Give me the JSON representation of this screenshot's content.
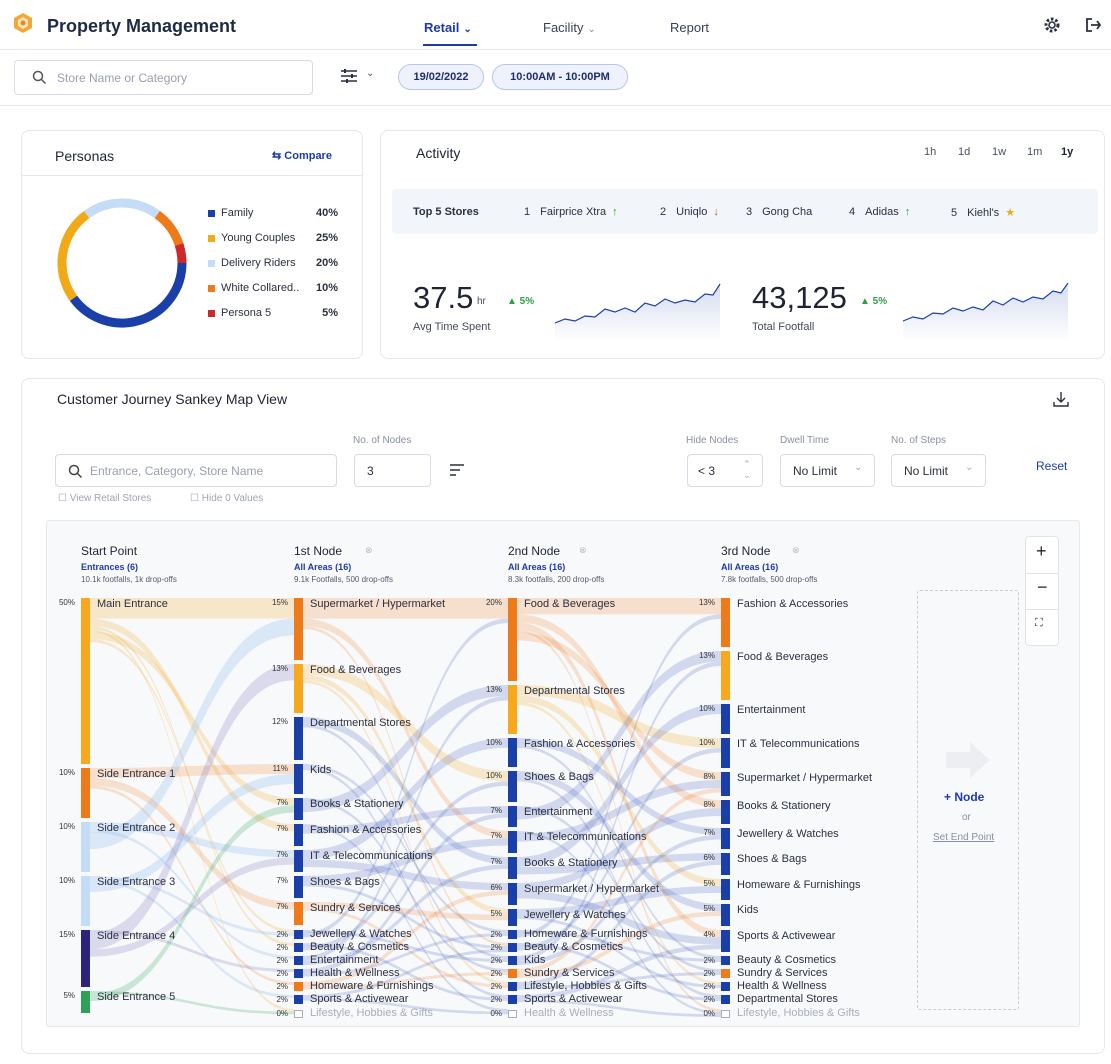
{
  "app": {
    "title": "Property Management"
  },
  "nav": {
    "retail": "Retail",
    "facility": "Facility",
    "report": "Report"
  },
  "filters": {
    "search_placeholder": "Store Name or Category",
    "date": "19/02/2022",
    "time": "10:00AM - 10:00PM"
  },
  "personas": {
    "title": "Personas",
    "compare": "Compare",
    "items": [
      {
        "label": "Family",
        "pct": "40%",
        "color": "#1a3fa8"
      },
      {
        "label": "Young Couples",
        "pct": "25%",
        "color": "#f2a918"
      },
      {
        "label": "Delivery Riders",
        "pct": "20%",
        "color": "#c4dcf5"
      },
      {
        "label": "White Collared..",
        "pct": "10%",
        "color": "#ef7a1a"
      },
      {
        "label": "Persona 5",
        "pct": "5%",
        "color": "#cc2a2a"
      }
    ]
  },
  "activity": {
    "title": "Activity",
    "ranges": [
      "1h",
      "1d",
      "1w",
      "1m",
      "1y"
    ],
    "top_label": "Top 5 Stores",
    "stores": [
      {
        "rank": "1",
        "name": "Fairprice Xtra",
        "trend": "↑"
      },
      {
        "rank": "2",
        "name": "Uniqlo",
        "trend": "↓"
      },
      {
        "rank": "3",
        "name": "Gong Cha",
        "trend": ""
      },
      {
        "rank": "4",
        "name": "Adidas",
        "trend": "↑"
      },
      {
        "rank": "5",
        "name": "Kiehl's",
        "trend": "★"
      }
    ],
    "metric1": {
      "value": "37.5",
      "unit": "hr",
      "change": "▲ 5%",
      "label": "Avg Time Spent"
    },
    "metric2": {
      "value": "43,125",
      "change": "▲ 5%",
      "label": "Total Footfall"
    }
  },
  "sankey": {
    "title": "Customer Journey Sankey Map View",
    "search_placeholder": "Entrance, Category, Store Name",
    "no_nodes_label": "No. of Nodes",
    "no_nodes_value": "3",
    "hide_nodes_label": "Hide Nodes",
    "hide_nodes_value": "< 3",
    "dwell_label": "Dwell Time",
    "dwell_value": "No Limit",
    "steps_label": "No. of Steps",
    "steps_value": "No Limit",
    "reset": "Reset",
    "view_retail": "View Retail Stores",
    "hide_zero": "Hide 0 Values",
    "add_node": "+ Node",
    "or": "or",
    "set_end": "Set End Point",
    "columns": [
      {
        "title": "Start Point",
        "sub": "Entrances (6)",
        "meta": "10.1k footfalls, 1k drop-offs",
        "nodes": [
          {
            "label": "Main Entrance",
            "pct": "50%",
            "color": "#f7a81c"
          },
          {
            "label": "Side Entrance 1",
            "pct": "10%",
            "color": "#ef7a1a"
          },
          {
            "label": "Side Entrance 2",
            "pct": "10%",
            "color": "#c4dcf5"
          },
          {
            "label": "Side Entrance 3",
            "pct": "10%",
            "color": "#c4dcf5"
          },
          {
            "label": "Side Entrance 4",
            "pct": "15%",
            "color": "#2e237a"
          },
          {
            "label": "Side Entrance 5",
            "pct": "5%",
            "color": "#2ea05a"
          }
        ]
      },
      {
        "title": "1st Node",
        "sub": "All Areas (16)",
        "meta": "9.1k Footfalls, 500 drop-offs",
        "nodes": [
          {
            "label": "Supermarket / Hypermarket",
            "pct": "15%",
            "color": "#ef7a1a"
          },
          {
            "label": "Food & Beverages",
            "pct": "13%",
            "color": "#f7a81c"
          },
          {
            "label": "Departmental Stores",
            "pct": "12%",
            "color": "#1a3fa8"
          },
          {
            "label": "Kids",
            "pct": "11%",
            "color": "#1a3fa8"
          },
          {
            "label": "Books & Stationery",
            "pct": "7%",
            "color": "#1a3fa8"
          },
          {
            "label": "Fashion & Accessories",
            "pct": "7%",
            "color": "#1a3fa8"
          },
          {
            "label": "IT & Telecommunications",
            "pct": "7%",
            "color": "#1a3fa8"
          },
          {
            "label": "Shoes & Bags",
            "pct": "7%",
            "color": "#1a3fa8"
          },
          {
            "label": "Sundry & Services",
            "pct": "7%",
            "color": "#ef7a1a"
          },
          {
            "label": "Jewellery & Watches",
            "pct": "2%",
            "color": "#1a3fa8"
          },
          {
            "label": "Beauty & Cosmetics",
            "pct": "2%",
            "color": "#1a3fa8"
          },
          {
            "label": "Entertainment",
            "pct": "2%",
            "color": "#1a3fa8"
          },
          {
            "label": "Health & Wellness",
            "pct": "2%",
            "color": "#1a3fa8"
          },
          {
            "label": "Homeware & Furnishings",
            "pct": "2%",
            "color": "#ef7a1a"
          },
          {
            "label": "Sports & Activewear",
            "pct": "2%",
            "color": "#1a3fa8"
          },
          {
            "label": "Lifestyle, Hobbies & Gifts",
            "pct": "0%",
            "color": "none"
          }
        ]
      },
      {
        "title": "2nd Node",
        "sub": "All Areas (16)",
        "meta": "8.3k footfalls, 200 drop-offs",
        "nodes": [
          {
            "label": "Food & Beverages",
            "pct": "20%",
            "color": "#ef7a1a"
          },
          {
            "label": "Departmental Stores",
            "pct": "13%",
            "color": "#f7a81c"
          },
          {
            "label": "Fashion & Accessories",
            "pct": "10%",
            "color": "#1a3fa8"
          },
          {
            "label": "Shoes & Bags",
            "pct": "10%",
            "color": "#1a3fa8"
          },
          {
            "label": "Entertainment",
            "pct": "7%",
            "color": "#1a3fa8"
          },
          {
            "label": "IT & Telecommunications",
            "pct": "7%",
            "color": "#1a3fa8"
          },
          {
            "label": "Books & Stationery",
            "pct": "7%",
            "color": "#1a3fa8"
          },
          {
            "label": "Supermarket / Hypermarket",
            "pct": "6%",
            "color": "#1a3fa8"
          },
          {
            "label": "Jewellery & Watches",
            "pct": "5%",
            "color": "#1a3fa8"
          },
          {
            "label": "Homeware & Furnishings",
            "pct": "2%",
            "color": "#1a3fa8"
          },
          {
            "label": "Beauty & Cosmetics",
            "pct": "2%",
            "color": "#1a3fa8"
          },
          {
            "label": "Kids",
            "pct": "2%",
            "color": "#1a3fa8"
          },
          {
            "label": "Sundry & Services",
            "pct": "2%",
            "color": "#ef7a1a"
          },
          {
            "label": "Lifestyle, Hobbies & Gifts",
            "pct": "2%",
            "color": "#1a3fa8"
          },
          {
            "label": "Sports & Activewear",
            "pct": "2%",
            "color": "#1a3fa8"
          },
          {
            "label": "Health & Wellness",
            "pct": "0%",
            "color": "none"
          }
        ]
      },
      {
        "title": "3rd Node",
        "sub": "All Areas (16)",
        "meta": "7.8k footfalls, 500 drop-offs",
        "nodes": [
          {
            "label": "Fashion & Accessories",
            "pct": "13%",
            "color": "#ef7a1a"
          },
          {
            "label": "Food & Beverages",
            "pct": "13%",
            "color": "#f7a81c"
          },
          {
            "label": "Entertainment",
            "pct": "10%",
            "color": "#1a3fa8"
          },
          {
            "label": "IT & Telecommunications",
            "pct": "10%",
            "color": "#1a3fa8"
          },
          {
            "label": "Supermarket / Hypermarket",
            "pct": "8%",
            "color": "#1a3fa8"
          },
          {
            "label": "Books & Stationery",
            "pct": "8%",
            "color": "#1a3fa8"
          },
          {
            "label": "Jewellery & Watches",
            "pct": "7%",
            "color": "#1a3fa8"
          },
          {
            "label": "Shoes & Bags",
            "pct": "6%",
            "color": "#1a3fa8"
          },
          {
            "label": "Homeware & Furnishings",
            "pct": "5%",
            "color": "#1a3fa8"
          },
          {
            "label": "Kids",
            "pct": "5%",
            "color": "#1a3fa8"
          },
          {
            "label": "Sports & Activewear",
            "pct": "4%",
            "color": "#1a3fa8"
          },
          {
            "label": "Beauty & Cosmetics",
            "pct": "2%",
            "color": "#1a3fa8"
          },
          {
            "label": "Sundry & Services",
            "pct": "2%",
            "color": "#ef7a1a"
          },
          {
            "label": "Health & Wellness",
            "pct": "2%",
            "color": "#1a3fa8"
          },
          {
            "label": "Departmental Stores",
            "pct": "2%",
            "color": "#1a3fa8"
          },
          {
            "label": "Lifestyle, Hobbies & Gifts",
            "pct": "0%",
            "color": "none"
          }
        ]
      }
    ]
  }
}
